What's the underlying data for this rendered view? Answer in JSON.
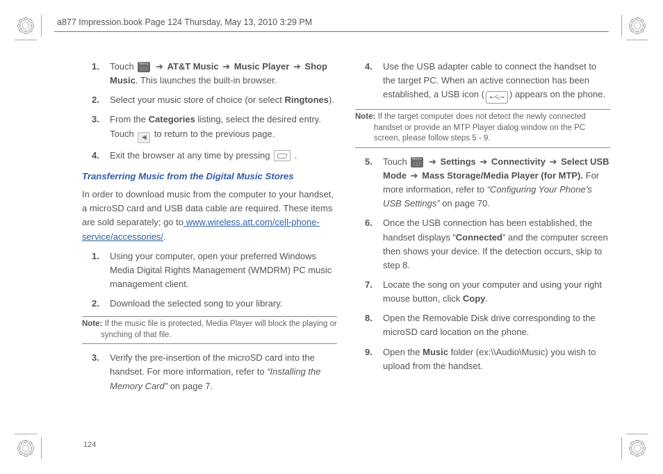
{
  "header_stamp": "a877 Impression.book  Page 124  Thursday, May 13, 2010  3:29 PM",
  "page_number": "124",
  "arrow": "➔",
  "left": {
    "steps_a": [
      {
        "num": "1.",
        "pre": "Touch ",
        "icon": "menu",
        "seq": [
          "AT&T Music",
          "Music Player",
          "Shop Music"
        ],
        "after": ". This launches the built-in browser."
      },
      {
        "num": "2.",
        "text_a": "Select your music store of choice (or select ",
        "bold": "Ringtones",
        "text_b": ")."
      },
      {
        "num": "3.",
        "text_a": "From the ",
        "bold": "Categories",
        "text_b": " listing, select the desired entry. Touch ",
        "icon": "back",
        "text_c": " to return to the previous page."
      },
      {
        "num": "4.",
        "text_a": "Exit the browser at any time by pressing ",
        "icon": "end",
        "text_b": " ."
      }
    ],
    "section_title": "Transferring Music from the Digital Music Stores",
    "intro_a": "In order to download music from the computer to your handset, a microSD card and USB data cable are required. These items are sold separately; go to",
    "intro_link": " www.wireless.att.com/cell-phone-service/accessories/",
    "intro_b": ".",
    "steps_b": [
      {
        "num": "1.",
        "text": "Using your computer, open your preferred Windows Media Digital Rights Management (WMDRM) PC music management client."
      },
      {
        "num": "2.",
        "text": "Download the selected song to your library."
      }
    ],
    "note": {
      "label": "Note:",
      "text": " If the music file is protected, Media Player will block the playing or synching of that file."
    },
    "steps_c": [
      {
        "num": "3.",
        "text_a": "Verify the pre-insertion of the microSD card into the handset. For more information, refer to ",
        "xref": "“Installing the Memory Card”",
        "text_b": "  on page 7."
      }
    ]
  },
  "right": {
    "steps_a": [
      {
        "num": "4.",
        "text_a": "Use the USB adapter cable to connect the handset to the target PC. When an active connection has been established, a USB icon (",
        "icon": "usb",
        "text_b": ") appears on the phone."
      }
    ],
    "note": {
      "label": "Note:",
      "text": " If the target computer does not detect the newly connected handset or provide an MTP Player dialog window on the PC screen, please follow steps 5 - 9."
    },
    "steps_b": [
      {
        "num": "5.",
        "pre": "Touch ",
        "icon": "menu",
        "seq": [
          "Settings",
          "Connectivity",
          "Select USB Mode",
          "Mass Storage/Media Player (for MTP)."
        ],
        "after_a": " For more information, refer to ",
        "xref": " “Configuring Your Phone’s USB Settings” ",
        "after_b": " on page 70."
      },
      {
        "num": "6.",
        "text_a": "Once the USB connection has been established, the handset displays “",
        "bold": "Connected",
        "text_b": "” and the computer screen then shows your device. If the detection occurs, skip to step 8."
      },
      {
        "num": "7.",
        "text_a": "Locate the song on your computer and using your right mouse button, click ",
        "bold": "Copy",
        "text_b": "."
      },
      {
        "num": "8.",
        "text": "Open the Removable Disk drive corresponding to the microSD card location on the phone."
      },
      {
        "num": "9.",
        "text_a": "Open the ",
        "bold": "Music",
        "text_b": " folder (ex:\\\\Audio\\Music) you wish to upload from the handset."
      }
    ]
  }
}
